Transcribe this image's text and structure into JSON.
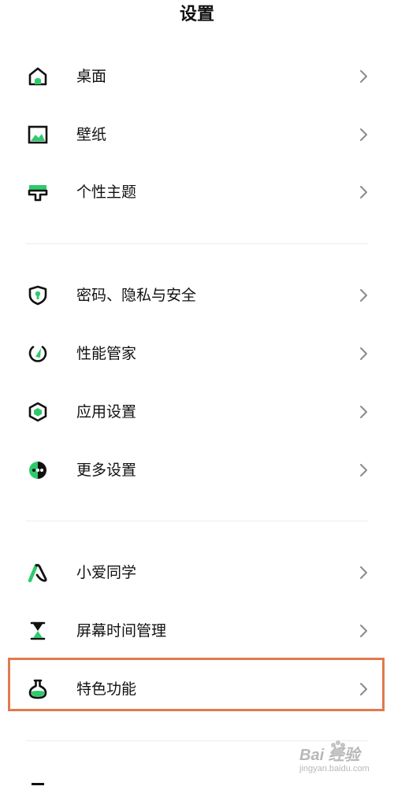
{
  "header": {
    "title": "设置"
  },
  "groups": [
    {
      "items": [
        {
          "label": "桌面",
          "icon": "home-icon"
        },
        {
          "label": "壁纸",
          "icon": "wallpaper-icon"
        },
        {
          "label": "个性主题",
          "icon": "theme-icon"
        }
      ]
    },
    {
      "items": [
        {
          "label": "密码、隐私与安全",
          "icon": "shield-icon"
        },
        {
          "label": "性能管家",
          "icon": "gauge-icon"
        },
        {
          "label": "应用设置",
          "icon": "hexagon-icon"
        },
        {
          "label": "更多设置",
          "icon": "more-dots-icon"
        }
      ]
    },
    {
      "items": [
        {
          "label": "小爱同学",
          "icon": "assistant-icon"
        },
        {
          "label": "屏幕时间管理",
          "icon": "hourglass-icon"
        },
        {
          "label": "特色功能",
          "icon": "flask-icon"
        }
      ]
    }
  ],
  "highlighted_item": "特色功能",
  "watermark": {
    "main": "Bai 经验",
    "sub": "jingyan.baidu.com"
  },
  "colors": {
    "accent": "#2fca6b",
    "text": "#111111",
    "chevron": "#8a8a8a",
    "divider": "#ececec",
    "highlight": "#e07a4e"
  }
}
